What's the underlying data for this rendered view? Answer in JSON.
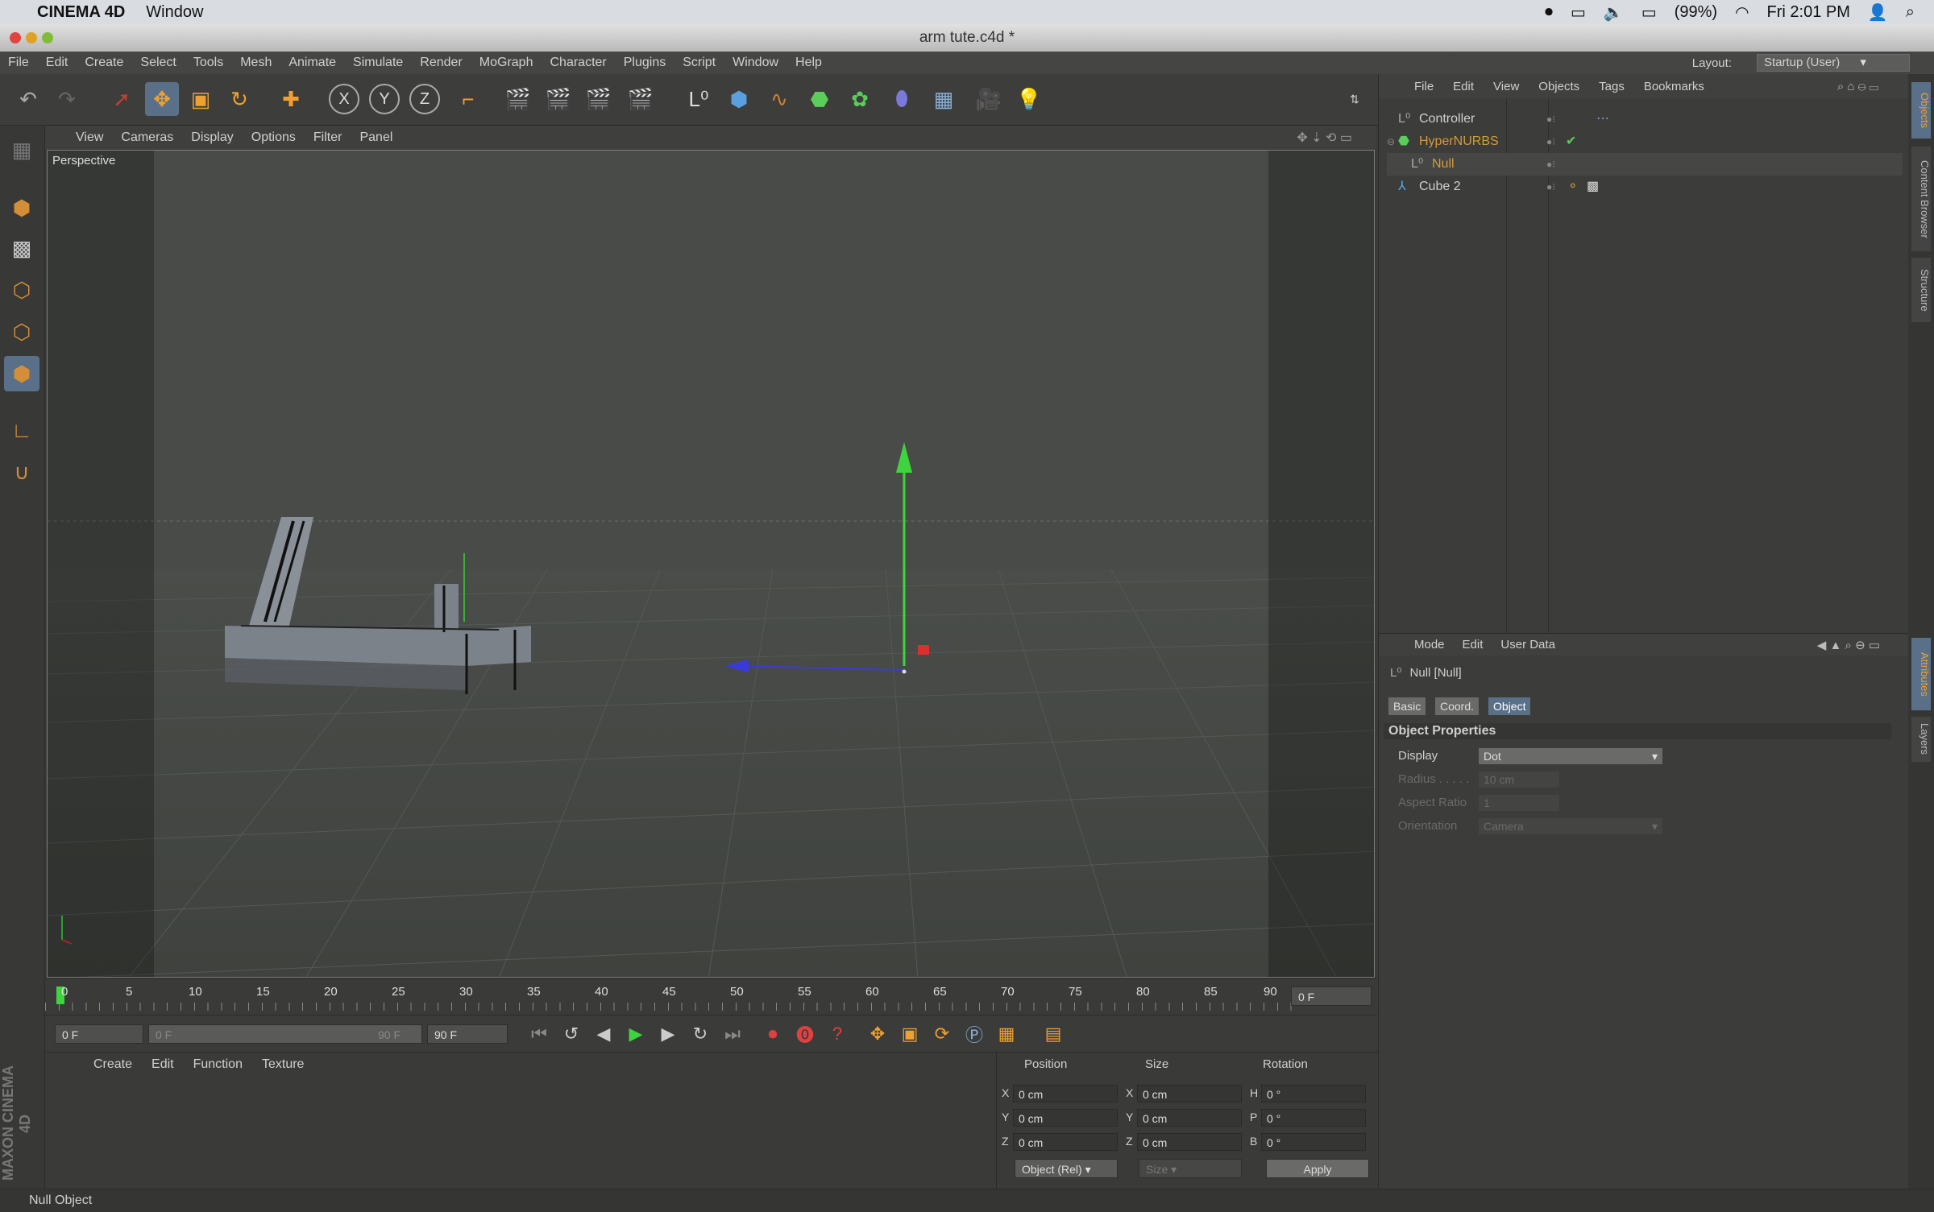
{
  "os": {
    "app": "CINEMA 4D",
    "menu": "Window",
    "battery": "(99%)",
    "clock": "Fri 2:01 PM"
  },
  "window": {
    "title": "arm tute.c4d *"
  },
  "menubar": {
    "items": [
      "File",
      "Edit",
      "Create",
      "Select",
      "Tools",
      "Mesh",
      "Animate",
      "Simulate",
      "Render",
      "MoGraph",
      "Character",
      "Plugins",
      "Script",
      "Window",
      "Help"
    ],
    "layout_label": "Layout:",
    "layout_value": "Startup (User)"
  },
  "viewport": {
    "menu": [
      "View",
      "Cameras",
      "Display",
      "Options",
      "Filter",
      "Panel"
    ],
    "label": "Perspective"
  },
  "object_manager": {
    "menu": [
      "File",
      "Edit",
      "View",
      "Objects",
      "Tags",
      "Bookmarks"
    ],
    "objects": [
      {
        "name": "Controller",
        "color": "#cfcfcf"
      },
      {
        "name": "HyperNURBS",
        "color": "#d49a3a"
      },
      {
        "name": "Null",
        "color": "#d49a3a"
      },
      {
        "name": "Cube 2",
        "color": "#cfcfcf"
      }
    ]
  },
  "attribute_manager": {
    "menu": [
      "Mode",
      "Edit",
      "User Data"
    ],
    "title": "Null [Null]",
    "tabs": [
      "Basic",
      "Coord.",
      "Object"
    ],
    "section": "Object Properties",
    "props": [
      {
        "label": "Display",
        "value": "Dot"
      },
      {
        "label": "Radius . . . . .",
        "value": "10 cm"
      },
      {
        "label": "Aspect Ratio",
        "value": "1"
      },
      {
        "label": "Orientation",
        "value": "Camera"
      }
    ]
  },
  "side_tabs": [
    "Objects",
    "Content Browser",
    "Structure",
    "Attributes",
    "Layers"
  ],
  "timeline": {
    "ticks": [
      "0",
      "5",
      "10",
      "15",
      "20",
      "25",
      "30",
      "35",
      "40",
      "45",
      "50",
      "55",
      "60",
      "65",
      "70",
      "75",
      "80",
      "85",
      "90"
    ],
    "current": "0 F"
  },
  "transport": {
    "start": "0 F",
    "range_start": "0 F",
    "range_end": "90 F",
    "end": "90 F"
  },
  "material_manager": {
    "menu": [
      "Create",
      "Edit",
      "Function",
      "Texture"
    ]
  },
  "coordinates": {
    "headers": [
      "Position",
      "Size",
      "Rotation"
    ],
    "rows": [
      {
        "axis": "X",
        "pos": "0 cm",
        "saxis": "X",
        "size": "0 cm",
        "raxis": "H",
        "rot": "0 °"
      },
      {
        "axis": "Y",
        "pos": "0 cm",
        "saxis": "Y",
        "size": "0 cm",
        "raxis": "P",
        "rot": "0 °"
      },
      {
        "axis": "Z",
        "pos": "0 cm",
        "saxis": "Z",
        "size": "0 cm",
        "raxis": "B",
        "rot": "0 °"
      }
    ],
    "mode": "Object (Rel)",
    "size_mode": "Size",
    "apply": "Apply"
  },
  "branding": "MAXON CINEMA 4D",
  "status": "Null Object"
}
